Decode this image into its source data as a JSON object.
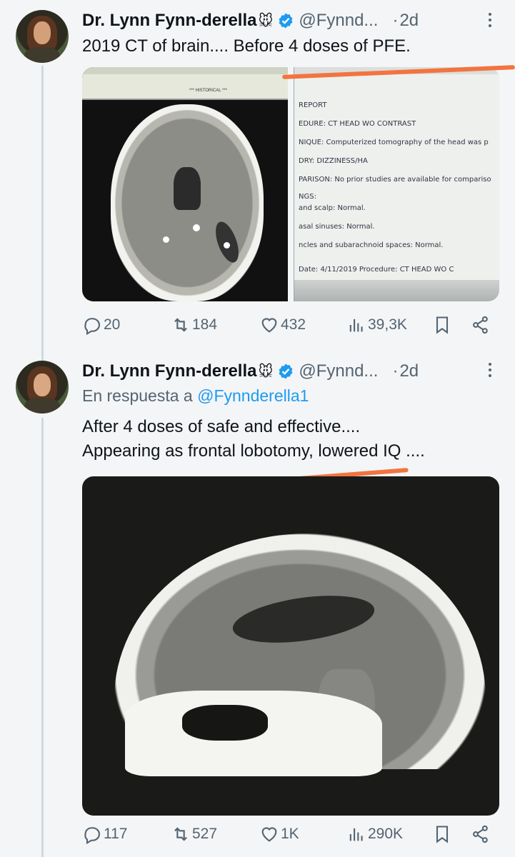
{
  "tweets": [
    {
      "author_name": "Dr. Lynn Fynn-derella",
      "author_emoji": "🐭",
      "handle": "@Fynnd...",
      "time": "2d",
      "text_lines": [
        "2019 CT of brain.... Before 4 doses of PFE."
      ],
      "media": {
        "report_lines": [
          "REPORT",
          "EDURE:  CT HEAD WO CONTRAST",
          "NIQUE:  Computerized tomography of the head was p",
          "DRY:  DIZZINESS/HA",
          "PARISON:  No prior studies are available for compariso",
          "NGS:",
          "and scalp: Normal.",
          "asal sinuses: Normal.",
          "ncles and subarachnoid spaces: Normal.",
          "Date: 4/11/2019      Procedure: CT HEAD WO C"
        ],
        "left_header": "*** HISTORICAL ***"
      },
      "stats": {
        "replies": "20",
        "reposts": "184",
        "likes": "432",
        "views": "39,3K"
      }
    },
    {
      "author_name": "Dr. Lynn Fynn-derella",
      "author_emoji": "🐭",
      "handle": "@Fynnd...",
      "time": "2d",
      "reply_prefix": "En respuesta a",
      "reply_to": "@Fynnderella1",
      "text_lines": [
        "After 4 doses of safe and effective....",
        "Appearing as frontal lobotomy, lowered IQ ...."
      ],
      "stats": {
        "replies": "117",
        "reposts": "527",
        "likes": "1K",
        "views": "290K"
      }
    }
  ],
  "colors": {
    "verified": "#1d9bf0",
    "annotation": "#f2743f",
    "muted": "#536471"
  }
}
